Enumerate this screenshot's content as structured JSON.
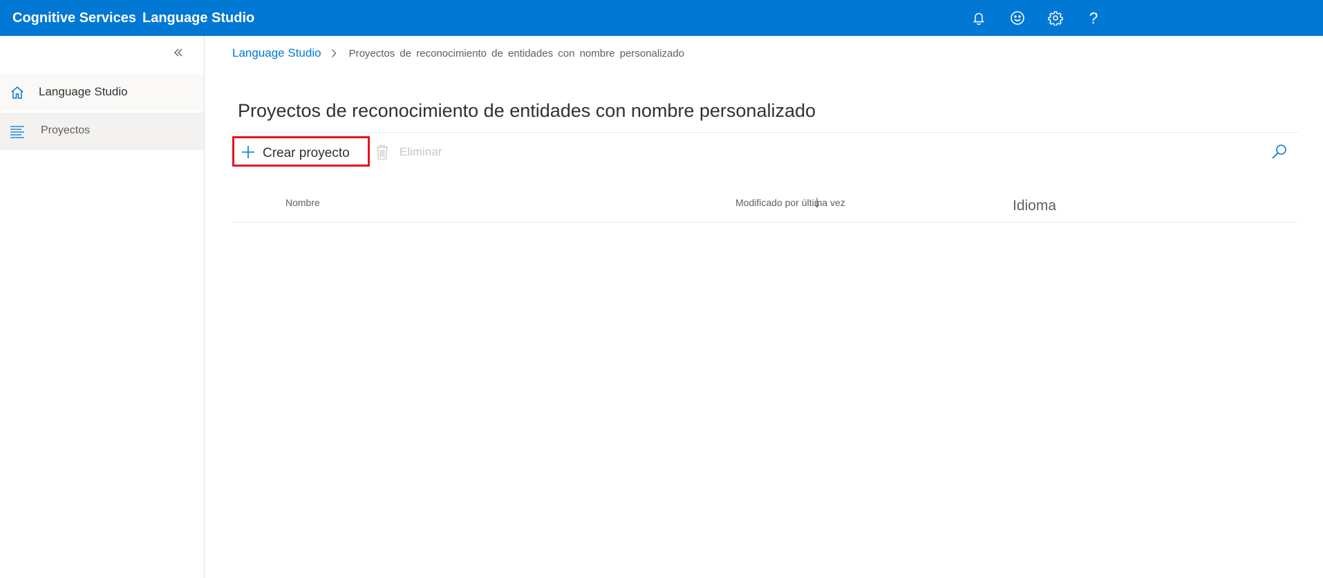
{
  "topbar": {
    "brand": "Cognitive Services",
    "product": "Language Studio",
    "icons": [
      "bell-icon",
      "smiley-icon",
      "gear-icon",
      "help-icon"
    ],
    "help_glyph": "?",
    "color": "#0078d4"
  },
  "sidebar": {
    "collapse_icon": "double-chevron-left-icon",
    "items": [
      {
        "label": "Language Studio",
        "icon": "home-icon"
      },
      {
        "label": "Proyectos",
        "icon": "list-icon",
        "selected": true
      }
    ]
  },
  "breadcrumb": {
    "root": "Language Studio",
    "current": "Proyectos de reconocimiento de entidades con nombre personalizado"
  },
  "page": {
    "title": "Proyectos de reconocimiento de entidades con nombre personalizado"
  },
  "toolbar": {
    "create_label": "Crear proyecto",
    "delete_label": "Eliminar",
    "search_icon": "search-icon"
  },
  "table": {
    "columns": [
      "Nombre",
      "Modificado por última vez",
      "Idioma"
    ],
    "sorted_column": "Modificado por última vez",
    "rows": []
  }
}
